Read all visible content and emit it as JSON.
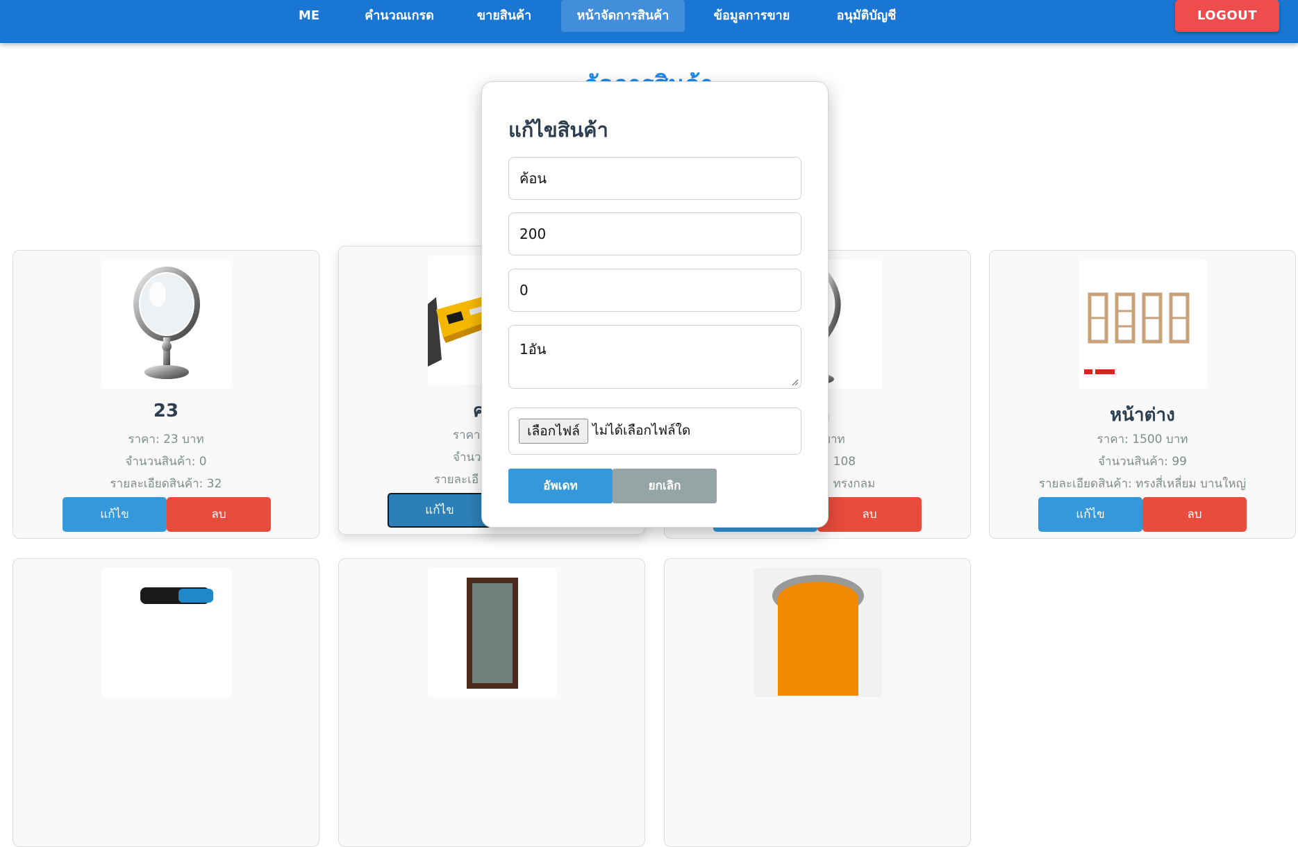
{
  "nav": {
    "items": [
      {
        "label": "ME"
      },
      {
        "label": "คำนวณเกรด"
      },
      {
        "label": "ขายสินค้า"
      },
      {
        "label": "หน้าจัดการสินค้า"
      },
      {
        "label": "ข้อมูลการขาย"
      },
      {
        "label": "อนุมัติบัญชี"
      }
    ],
    "active_index": 3,
    "logout_label": "LOGOUT"
  },
  "page_title": "จัดการสินค้า",
  "products": [
    {
      "name": "23",
      "price": "ราคา: 23 บาท",
      "qty": "จำนวนสินค้า: 0",
      "detail": "รายละเอียดสินค้า: 32",
      "image": "mirror-image"
    },
    {
      "name": "ค",
      "price": "ราคา:",
      "qty": "จำนว",
      "detail": "รายละเอี",
      "image": "hammer-image"
    },
    {
      "name": "ก",
      "price": "0 บาท",
      "qty": "า: 108",
      "detail": "า: ทรงกลม",
      "image": "mirror-image"
    },
    {
      "name": "หน้าต่าง",
      "price": "ราคา: 1500 บาท",
      "qty": "จำนวนสินค้า: 99",
      "detail": "รายละเอียดสินค้า: ทรงสี่เหลี่ยม บานใหญ่",
      "image": "window-frame-image"
    }
  ],
  "buttons": {
    "edit": "แก้ไข",
    "delete": "ลบ"
  },
  "modal": {
    "title": "แก้ไขสินค้า",
    "name_value": "ค้อน",
    "price_value": "200",
    "qty_value": "0",
    "detail_value": "1อัน",
    "file_button": "เลือกไฟล์",
    "file_status": "ไม่ได้เลือกไฟล์ใด",
    "update_label": "อัพเดท",
    "cancel_label": "ยกเลิก"
  },
  "colors": {
    "navbar": "#1976d2",
    "logout": "#ef4d4d",
    "title": "#1e88e5",
    "edit": "#3498db",
    "delete": "#e74c3c",
    "cancel": "#95a5a6"
  }
}
